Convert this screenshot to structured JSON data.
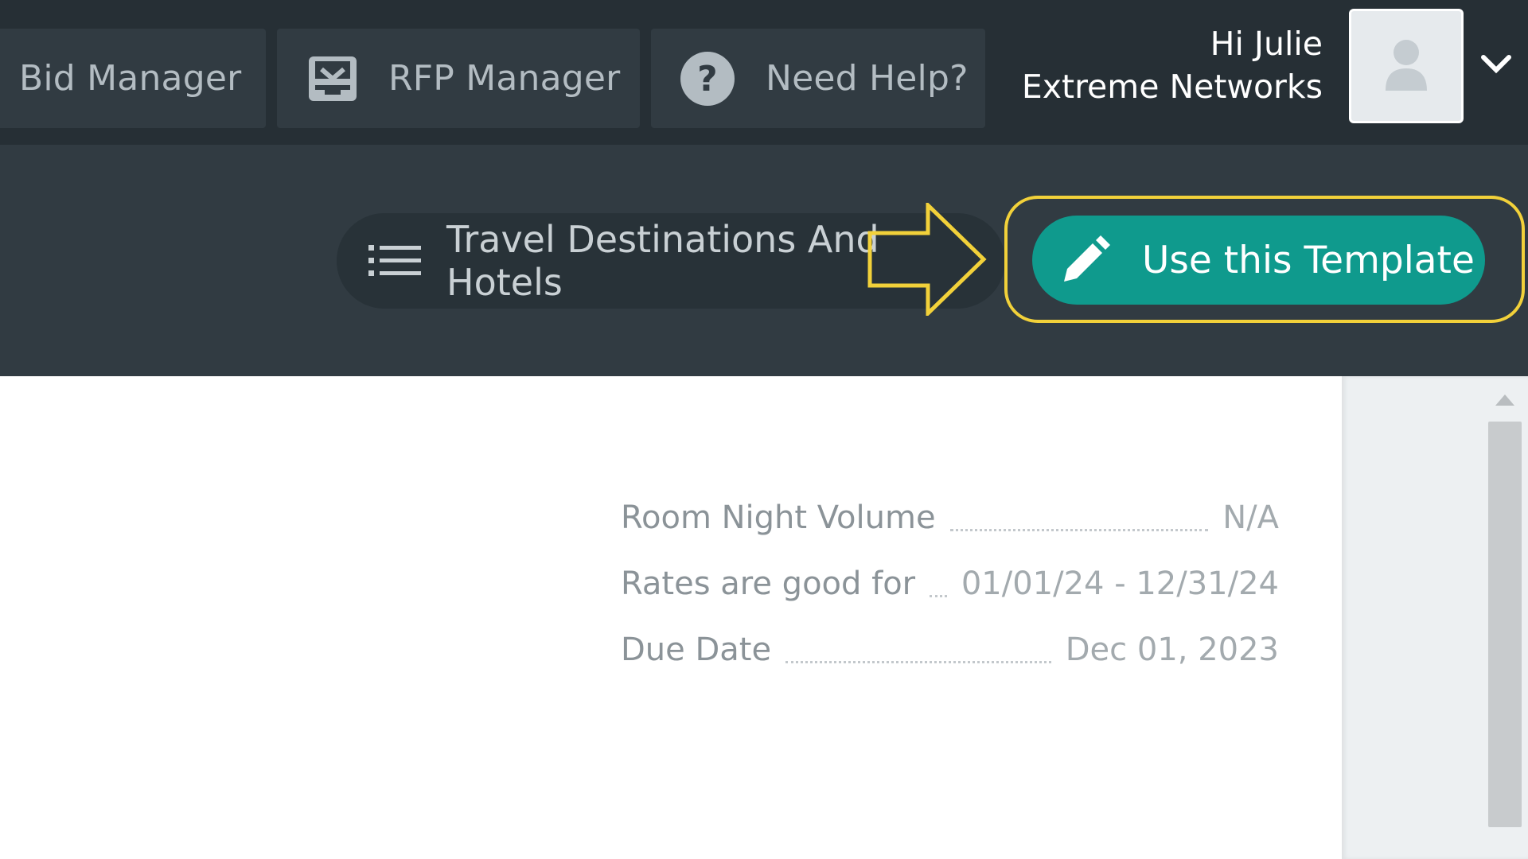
{
  "nav": {
    "bid_manager": "Bid Manager",
    "rfp_manager": "RFP Manager",
    "need_help": "Need Help?"
  },
  "user": {
    "greeting": "Hi Julie",
    "company": "Extreme Networks"
  },
  "toolbar": {
    "template_name": "Travel Destinations And Hotels",
    "use_template_label": "Use this Template"
  },
  "details": [
    {
      "label": "Room Night Volume",
      "value": "N/A"
    },
    {
      "label": "Rates are good for",
      "value": "01/01/24 - 12/31/24"
    },
    {
      "label": "Due Date",
      "value": "Dec 01, 2023"
    }
  ],
  "icons": {
    "rfp": "inbox-tray-icon",
    "help": "question-circle-icon",
    "avatar": "user-silhouette-icon",
    "menu": "chevron-down-icon",
    "template": "list-icon",
    "edit": "pencil-icon",
    "annotation": "arrow-right-icon"
  },
  "colors": {
    "topbar": "#262f35",
    "subheader": "#313b42",
    "accent": "#0f9a8d",
    "highlight": "#f2d13a"
  }
}
